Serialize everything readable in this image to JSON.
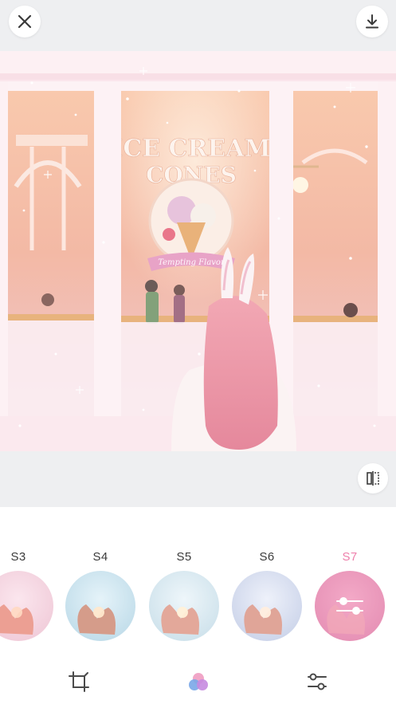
{
  "toolbar_top": {
    "close_icon": "close-icon",
    "download_icon": "download-icon"
  },
  "photo": {
    "sign_line1": "ICE CREAM",
    "sign_line2": "CONES",
    "sign_ribbon": "Tempting Flavor"
  },
  "compare": {
    "icon": "compare-icon"
  },
  "filters": [
    {
      "label": "S3",
      "selected": false
    },
    {
      "label": "S4",
      "selected": false
    },
    {
      "label": "S5",
      "selected": false
    },
    {
      "label": "S6",
      "selected": false
    },
    {
      "label": "S7",
      "selected": true
    }
  ],
  "bottom_tools": [
    {
      "icon": "crop-icon"
    },
    {
      "icon": "filters-icon",
      "active": true
    },
    {
      "icon": "adjust-icon"
    }
  ],
  "colors": {
    "accent": "#ee7fab",
    "background": "#eeeff1",
    "panel": "#ffffff",
    "filter_active_bg": "#e98fb6"
  }
}
